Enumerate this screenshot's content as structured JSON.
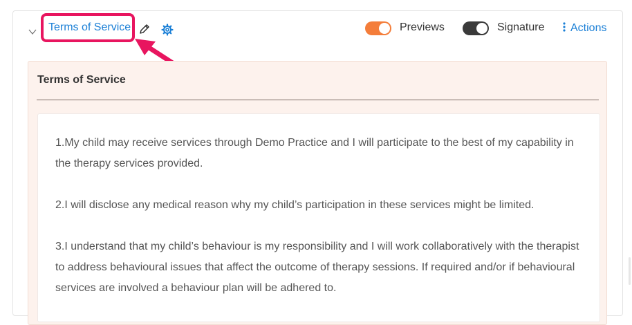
{
  "header": {
    "title": "Terms of Service",
    "previews_label": "Previews",
    "signature_label": "Signature",
    "actions_label": "Actions",
    "previews_on": true,
    "signature_on": true
  },
  "panel": {
    "title": "Terms of Service",
    "paragraphs": [
      "1.My child may receive services through Demo Practice and I will participate to the best of my capability in the therapy services provided.",
      "2.I will disclose any medical reason why my child’s participation in these services might be limited.",
      "3.I understand that my child’s behaviour is my responsibility and I will work collaboratively with the therapist to address behavioural issues that affect the outcome of therapy sessions. If required and/or if behavioural services are involved a behaviour plan will be adhered to."
    ]
  },
  "colors": {
    "link": "#1a7fd6",
    "highlight": "#e8155f",
    "previews_toggle": "#f47d3a",
    "signature_toggle": "#3a3a3a",
    "panel_bg": "#fdf2ed"
  },
  "icons": [
    "chevron-down-icon",
    "pencil-icon",
    "gear-icon",
    "more-vertical-icon"
  ]
}
